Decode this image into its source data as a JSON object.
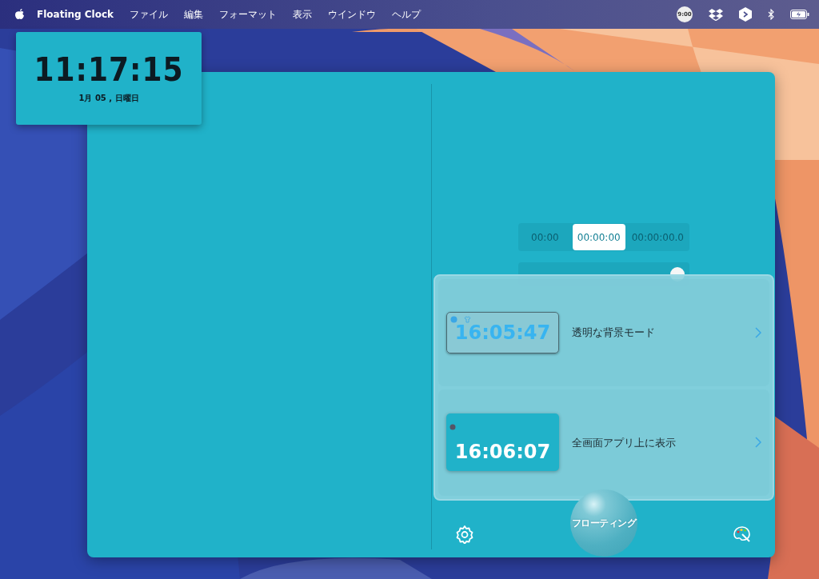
{
  "menubar": {
    "app_name": "Floating Clock",
    "menus": [
      "ファイル",
      "編集",
      "フォーマット",
      "表示",
      "ウインドウ",
      "ヘルプ"
    ],
    "status_clock": "9:00"
  },
  "floating_clock": {
    "time": "11:17:15",
    "date": "1月 05 , 日曜日"
  },
  "format_options": [
    {
      "label": "00:00",
      "selected": false
    },
    {
      "label": "00:00:00",
      "selected": true
    },
    {
      "label": "00:00:00.0",
      "selected": false
    }
  ],
  "popover": {
    "items": [
      {
        "kind": "transparent",
        "preview_time": "16:05:47",
        "label": "透明な背景モード"
      },
      {
        "kind": "solid",
        "preview_time": "16:06:07",
        "label": "全画面アプリ上に表示"
      }
    ]
  },
  "bottom_bar": {
    "floating_button": "フローティング"
  }
}
